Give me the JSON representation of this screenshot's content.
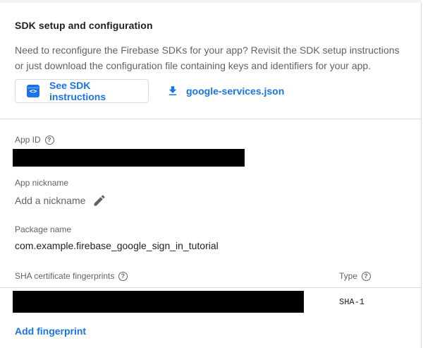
{
  "section": {
    "title": "SDK setup and configuration",
    "description": "Need to reconfigure the Firebase SDKs for your app? Revisit the SDK setup instructions or just download the configuration file containing keys and identifiers for your app."
  },
  "actions": {
    "sdk_button_label": "See SDK instructions",
    "sdk_icon_glyph": "<>",
    "json_link_label": "google-services.json"
  },
  "app_id": {
    "label": "App ID",
    "help_glyph": "?"
  },
  "nickname": {
    "label": "App nickname",
    "placeholder": "Add a nickname"
  },
  "package": {
    "label": "Package name",
    "value": "com.example.firebase_google_sign_in_tutorial"
  },
  "fingerprints": {
    "label": "SHA certificate fingerprints",
    "type_label": "Type",
    "help_glyph": "?",
    "rows": [
      {
        "type": "SHA-1"
      }
    ],
    "add_label": "Add fingerprint"
  },
  "colors": {
    "accent": "#1a73e8",
    "text_primary": "#202124",
    "text_secondary": "#5f6368",
    "divider": "#dadce0",
    "redaction": "#000000"
  },
  "icons": {
    "sdk": "code-window-icon",
    "download": "download-icon",
    "help": "help-circle-icon",
    "edit": "pencil-icon"
  }
}
